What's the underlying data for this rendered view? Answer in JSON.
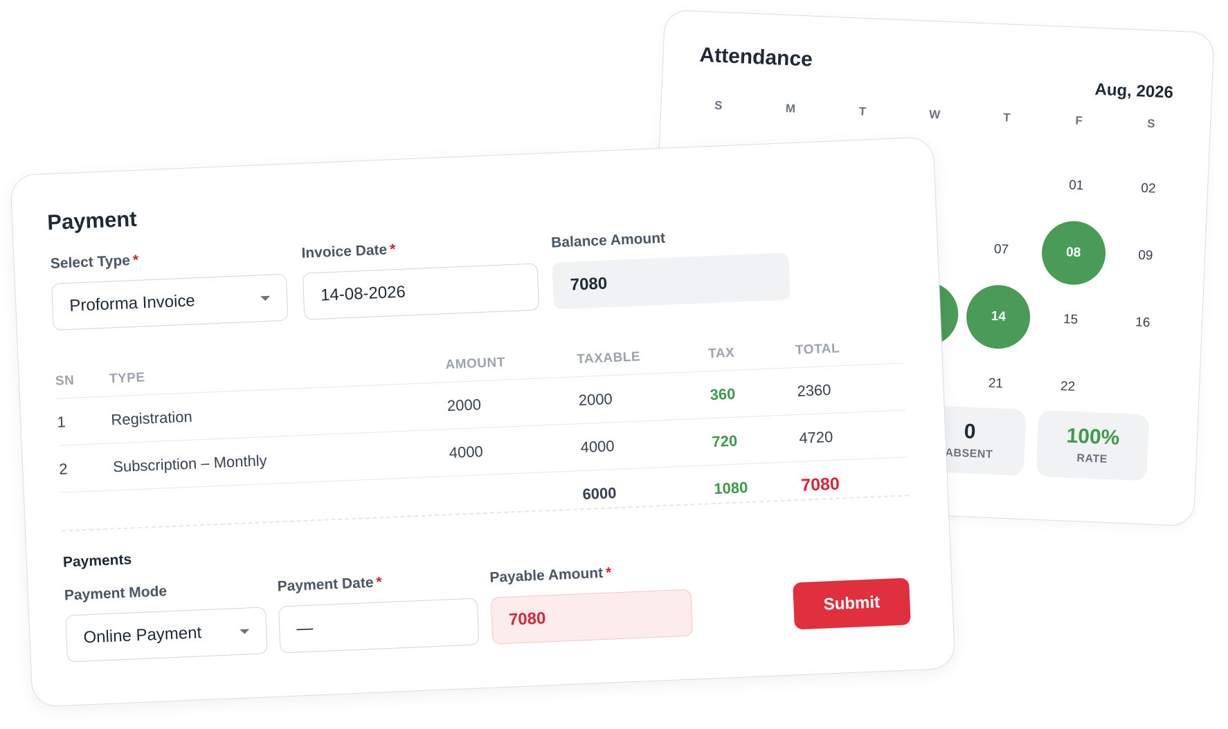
{
  "attendance": {
    "title": "Attendance",
    "month": "Aug, 2026",
    "weekdays": [
      "S",
      "M",
      "T",
      "W",
      "T",
      "F",
      "S"
    ],
    "days": [
      {
        "label": "",
        "status": "none"
      },
      {
        "label": "",
        "status": "none"
      },
      {
        "label": "",
        "status": "none"
      },
      {
        "label": "",
        "status": "none"
      },
      {
        "label": "",
        "status": "none"
      },
      {
        "label": "01",
        "status": "none"
      },
      {
        "label": "02",
        "status": "none"
      },
      {
        "label": "",
        "status": "none"
      },
      {
        "label": "",
        "status": "none"
      },
      {
        "label": "",
        "status": "none"
      },
      {
        "label": "",
        "status": "none"
      },
      {
        "label": "07",
        "status": "none"
      },
      {
        "label": "08",
        "status": "present"
      },
      {
        "label": "09",
        "status": "none"
      },
      {
        "label": "",
        "status": "none"
      },
      {
        "label": "",
        "status": "none"
      },
      {
        "label": "",
        "status": "none"
      },
      {
        "label": "",
        "status": "present"
      },
      {
        "label": "14",
        "status": "present"
      },
      {
        "label": "15",
        "status": "none"
      },
      {
        "label": "16",
        "status": "none"
      },
      {
        "label": "",
        "status": "none"
      },
      {
        "label": "",
        "status": "none"
      },
      {
        "label": "",
        "status": "none"
      },
      {
        "label": "",
        "status": "none"
      },
      {
        "label": "21",
        "status": "none"
      },
      {
        "label": "22",
        "status": "none"
      },
      {
        "label": "",
        "status": "none"
      }
    ],
    "stats": {
      "absent_value": "0",
      "absent_label": "ABSENT",
      "rate_value": "100%",
      "rate_label": "RATE"
    }
  },
  "payment": {
    "title": "Payment",
    "select_type": {
      "label": "Select Type",
      "value": "Proforma Invoice"
    },
    "invoice_date": {
      "label": "Invoice Date",
      "value": "14-08-2026"
    },
    "balance": {
      "label": "Balance Amount",
      "value": "7080"
    },
    "table": {
      "headers": [
        "SN",
        "TYPE",
        "AMOUNT",
        "TAXABLE",
        "TAX",
        "TOTAL"
      ],
      "rows": [
        {
          "sn": "1",
          "type": "Registration",
          "amount": "2000",
          "taxable": "2000",
          "tax": "360",
          "total": "2360"
        },
        {
          "sn": "2",
          "type": "Subscription – Monthly",
          "amount": "4000",
          "taxable": "4000",
          "tax": "720",
          "total": "4720"
        }
      ],
      "totals": {
        "taxable": "6000",
        "tax": "1080",
        "total": "7080"
      }
    },
    "payments_title": "Payments",
    "payment_mode": {
      "label": "Payment Mode",
      "value": "Online Payment"
    },
    "payment_date": {
      "label": "Payment Date",
      "value": "—"
    },
    "payable": {
      "label": "Payable Amount",
      "value": "7080"
    },
    "required_mark": "*",
    "submit_label": "Submit"
  },
  "colors": {
    "present": "#4a9a58",
    "accent_red": "#e0303e",
    "green_text": "#3f9a4d"
  }
}
